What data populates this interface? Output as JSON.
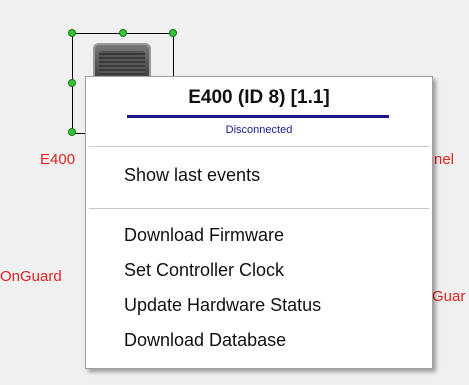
{
  "canvas": {
    "labels": {
      "device_left": "E400",
      "right_edge": "nel",
      "onguard_left": "OnGuard",
      "onguard_right": "Guar"
    }
  },
  "menu": {
    "title": "E400 (ID 8) [1.1]",
    "status": "Disconnected",
    "items": [
      "Show last events",
      "Download Firmware",
      "Set Controller Clock",
      "Update Hardware Status",
      "Download Database"
    ]
  },
  "colors": {
    "label_red": "#e22222",
    "status_blue": "#1a1a8c",
    "handle_green": "#35c235"
  },
  "icons": {
    "device": "controller-device-icon"
  }
}
